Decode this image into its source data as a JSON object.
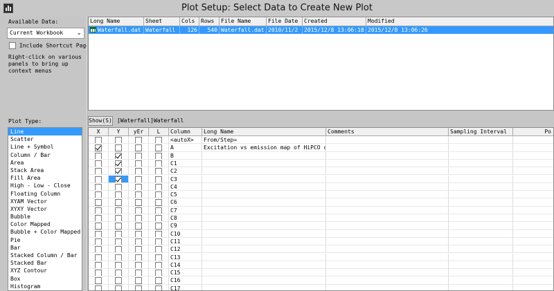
{
  "window": {
    "title": "Plot Setup: Select Data to Create New Plot"
  },
  "available_data": {
    "label": "Available Data:",
    "selected": "Current Workbook",
    "include_shortcut_label": "Include Shortcut Page",
    "include_shortcut_checked": false,
    "hint": "Right-click on various panels to bring up context menus"
  },
  "top_grid": {
    "headers": [
      "Long Name",
      "Sheet",
      "Cols",
      "Rows",
      "File Name",
      "File Date",
      "Created",
      "Modified"
    ],
    "row": {
      "long_name": "Waterfall.dat",
      "sheet": "Waterfall",
      "cols": "126",
      "rows": "540",
      "file_name": "Waterfall.dat",
      "file_date": "2010/11/2",
      "created": "2015/12/8 13:06:18",
      "modified": "2015/12/8 13:06:26"
    }
  },
  "plot_type": {
    "label": "Plot Type:",
    "selected_index": 0,
    "items": [
      "Line",
      "Scatter",
      "Line + Symbol",
      "Column / Bar",
      "Area",
      "Stack Area",
      "Fill Area",
      "High - Low - Close",
      "Floating Column",
      "XYAM Vector",
      "XYXY Vector",
      "Bubble",
      "Color Mapped",
      "Bubble + Color Mapped",
      "Pie",
      "Bar",
      "Stacked Column / Bar",
      "Stacked Bar",
      "XYZ Contour",
      "Box",
      "Histogram"
    ]
  },
  "column_panel": {
    "show_button": "Show(S)",
    "book_sheet": "[Waterfall]Waterfall",
    "headers": {
      "x": "X",
      "y": "Y",
      "yer": "yEr",
      "l": "L",
      "column": "Column",
      "long_name": "Long Name",
      "comments": "Comments",
      "sampling": "Sampling Interval",
      "extra": "Po"
    },
    "rows": [
      {
        "column": "<autoX>",
        "long_name": "From/Step=",
        "x": false,
        "y": false,
        "yer": false,
        "l": false
      },
      {
        "column": "A",
        "long_name": "Excitation vs emission map of HiPCO car",
        "x": true,
        "y": false,
        "yer": false,
        "l": false
      },
      {
        "column": "B",
        "long_name": "",
        "x": false,
        "y": true,
        "yer": false,
        "l": false
      },
      {
        "column": "C1",
        "long_name": "",
        "x": false,
        "y": true,
        "yer": false,
        "l": false
      },
      {
        "column": "C2",
        "long_name": "",
        "x": false,
        "y": true,
        "yer": false,
        "l": false
      },
      {
        "column": "C3",
        "long_name": "",
        "x": false,
        "y": true,
        "yer": false,
        "l": false,
        "active_y": true
      },
      {
        "column": "C4",
        "long_name": "",
        "x": false,
        "y": false,
        "yer": false,
        "l": false
      },
      {
        "column": "C5",
        "long_name": "",
        "x": false,
        "y": false,
        "yer": false,
        "l": false
      },
      {
        "column": "C6",
        "long_name": "",
        "x": false,
        "y": false,
        "yer": false,
        "l": false
      },
      {
        "column": "C7",
        "long_name": "",
        "x": false,
        "y": false,
        "yer": false,
        "l": false
      },
      {
        "column": "C8",
        "long_name": "",
        "x": false,
        "y": false,
        "yer": false,
        "l": false
      },
      {
        "column": "C9",
        "long_name": "",
        "x": false,
        "y": false,
        "yer": false,
        "l": false
      },
      {
        "column": "C10",
        "long_name": "",
        "x": false,
        "y": false,
        "yer": false,
        "l": false
      },
      {
        "column": "C11",
        "long_name": "",
        "x": false,
        "y": false,
        "yer": false,
        "l": false
      },
      {
        "column": "C12",
        "long_name": "",
        "x": false,
        "y": false,
        "yer": false,
        "l": false
      },
      {
        "column": "C13",
        "long_name": "",
        "x": false,
        "y": false,
        "yer": false,
        "l": false
      },
      {
        "column": "C14",
        "long_name": "",
        "x": false,
        "y": false,
        "yer": false,
        "l": false
      },
      {
        "column": "C15",
        "long_name": "",
        "x": false,
        "y": false,
        "yer": false,
        "l": false
      },
      {
        "column": "C16",
        "long_name": "",
        "x": false,
        "y": false,
        "yer": false,
        "l": false
      },
      {
        "column": "C17",
        "long_name": "",
        "x": false,
        "y": false,
        "yer": false,
        "l": false
      }
    ]
  },
  "colors": {
    "selection": "#3399ff",
    "background": "#c6c6c6"
  }
}
